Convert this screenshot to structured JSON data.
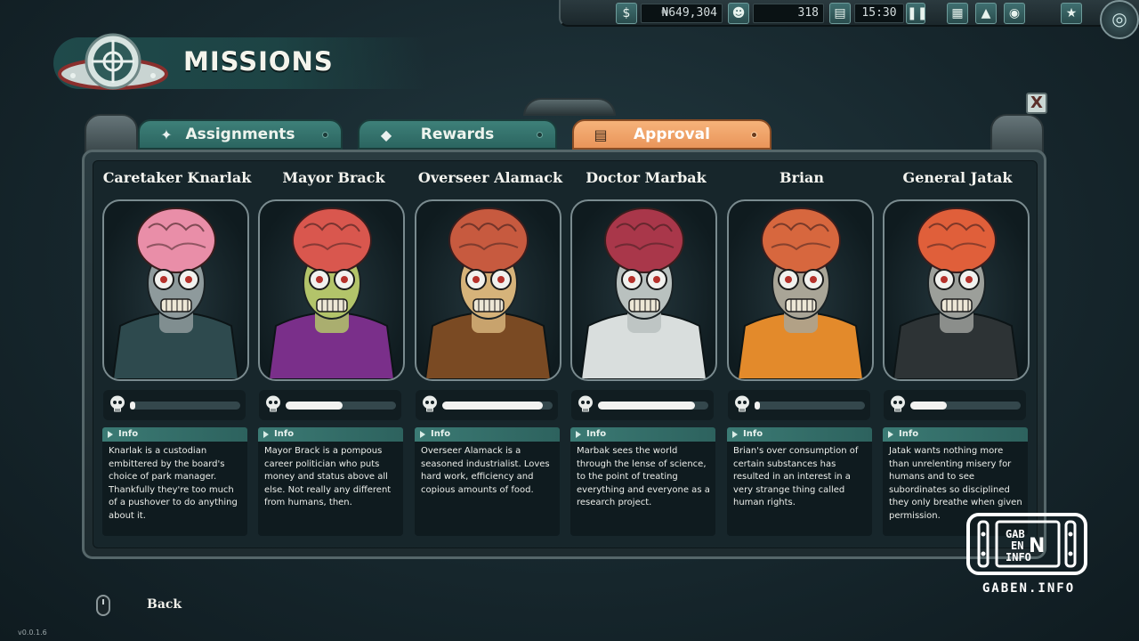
{
  "hud": {
    "money_icon": "dollar-icon",
    "money": "₦649,304",
    "visitors_icon": "person-icon",
    "visitors": "318",
    "clock_icon": "document-icon",
    "time": "15:30",
    "pause_icon": "pause-icon",
    "buttons": [
      "build-menu-icon",
      "research-flask-icon",
      "ufo-icon",
      "mission-badge-icon"
    ],
    "menu_icon": "radar-icon"
  },
  "page": {
    "title": "MISSIONS",
    "logo_icon": "ufo-target-logo"
  },
  "tabs": [
    {
      "label": "Assignments",
      "icon": "compass-icon",
      "active": false
    },
    {
      "label": "Rewards",
      "icon": "lock-icon",
      "active": false
    },
    {
      "label": "Approval",
      "icon": "clipboard-icon",
      "active": true
    }
  ],
  "close_label": "X",
  "info_label": "Info",
  "characters": [
    {
      "name": "Caretaker Knarlak",
      "approval": 0.04,
      "brain_color": "#e98ea8",
      "skin_color": "#8e9a9c",
      "suit_color": "#2e4a4e",
      "info": "Knarlak is a custodian embittered by the board's choice of park manager. Thankfully they're too much of a pushover to do anything about it."
    },
    {
      "name": "Mayor Brack",
      "approval": 0.52,
      "brain_color": "#d9574e",
      "skin_color": "#b3c46a",
      "suit_color": "#7a2f8a",
      "info": "Mayor Brack is a pompous career politician who puts money and status above all else. Not really any different from humans, then."
    },
    {
      "name": "Overseer Alamack",
      "approval": 0.91,
      "brain_color": "#c75a3f",
      "skin_color": "#d6b37a",
      "suit_color": "#7a4a23",
      "info": "Overseer Alamack is a seasoned industrialist. Loves hard work, efficiency and copious amounts of food."
    },
    {
      "name": "Doctor Marbak",
      "approval": 0.88,
      "brain_color": "#a9374a",
      "skin_color": "#b9c1bf",
      "suit_color": "#d9dedd",
      "info": "Marbak sees the world through the lense of science, to the point of treating everything and everyone as a research project."
    },
    {
      "name": "Brian",
      "approval": 0.04,
      "brain_color": "#d7673e",
      "skin_color": "#a9a597",
      "suit_color": "#e38a2b",
      "info": "Brian's over consumption of certain substances has resulted in an interest in a very strange thing called human rights."
    },
    {
      "name": "General Jatak",
      "approval": 0.33,
      "brain_color": "#e05f3a",
      "skin_color": "#9c9f9a",
      "suit_color": "#2d3335",
      "info": "Jatak wants nothing more than unrelenting misery for humans and to see subordinates so disciplined they only breathe when given permission."
    }
  ],
  "footer": {
    "back_label": "Back",
    "version": "v0.0.1.6"
  },
  "watermark": {
    "logo_lines": [
      "GAB",
      "EN",
      "INFO"
    ],
    "text": "GABEN.INFO"
  }
}
